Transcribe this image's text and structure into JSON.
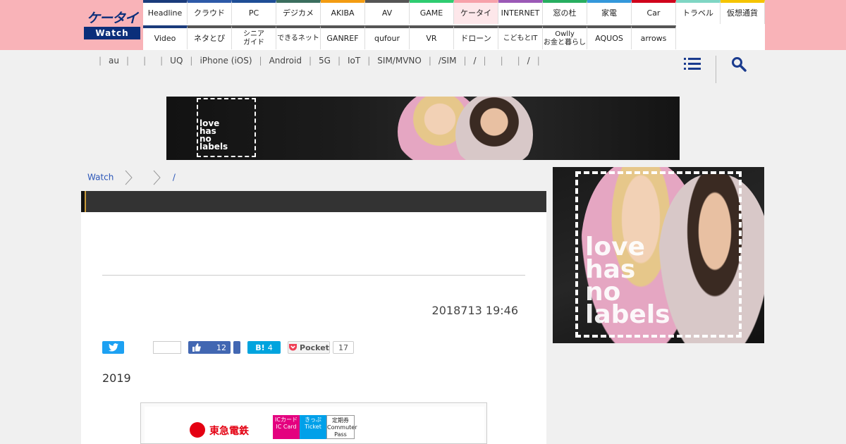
{
  "logo": {
    "top": "ケータイ",
    "bottom": "Watch"
  },
  "nav": {
    "row1": [
      {
        "label": "Headline",
        "color": "#1a3b7b"
      },
      {
        "label": "クラウド",
        "color": "#2e5aa8"
      },
      {
        "label": "PC",
        "color": "#1f4e96"
      },
      {
        "label": "デジカメ",
        "color": "#3b6e5e"
      },
      {
        "label": "AKIBA",
        "color": "#f39c12"
      },
      {
        "label": "AV",
        "color": "#555555"
      },
      {
        "label": "GAME",
        "color": "#2ecc71"
      },
      {
        "label": "ケータイ",
        "color": "#f7a1aa",
        "active": true
      },
      {
        "label": "INTERNET",
        "color": "#9b59b6"
      },
      {
        "label": "窓の杜",
        "color": "#27ae60"
      },
      {
        "label": "家電",
        "color": "#3498db"
      },
      {
        "label": "Car",
        "color": "#d0021b"
      },
      {
        "label": "トラベル",
        "color": "#7fd6c4"
      },
      {
        "label": "仮想通貨",
        "color": "#f5c400"
      }
    ],
    "row2": [
      {
        "label": "Video",
        "color": "#1a3b7b"
      },
      {
        "label": "ネタとぴ",
        "color": "#555555"
      },
      {
        "label": "シニア\nガイド",
        "color": "#555555"
      },
      {
        "label": "できるネット",
        "color": "#555555"
      },
      {
        "label": "GANREF",
        "color": "#555555"
      },
      {
        "label": "qufour",
        "color": "#555555"
      },
      {
        "label": "VR",
        "color": "#555555"
      },
      {
        "label": "ドローン",
        "color": "#555555"
      },
      {
        "label": "こどもとIT",
        "color": "#555555"
      },
      {
        "label": "Owlly\nお金と暮らし",
        "color": "#555555"
      },
      {
        "label": "AQUOS",
        "color": "#555555"
      },
      {
        "label": "arrows",
        "color": "#555555"
      }
    ]
  },
  "subnav": [
    "",
    "au",
    "",
    "",
    "UQ",
    "iPhone (iOS)",
    "Android",
    "5G",
    "IoT",
    "SIM/MVNO",
    "/SIM",
    "",
    "/",
    "",
    "",
    "",
    "/",
    ""
  ],
  "banner_ad": {
    "text": "love\nhas\nno\nlabels"
  },
  "breadcrumb": {
    "home": "Watch",
    "sep": "/"
  },
  "article": {
    "date": "2018713 19:46",
    "body": "2019",
    "social": {
      "like_count": "12",
      "hatena_count": "4",
      "hatena_label": "B!",
      "pocket_label": "Pocket",
      "pocket_count": "17"
    },
    "figure": {
      "brand": "東急電鉄",
      "sign_ic": "ICカード\nIC Card",
      "sign_ticket": "きっぷ\nTicket",
      "sign_pass": "定期券\nCommuter Pass"
    }
  },
  "side_ad": {
    "text": "love\nhas\nno\nlabels"
  }
}
